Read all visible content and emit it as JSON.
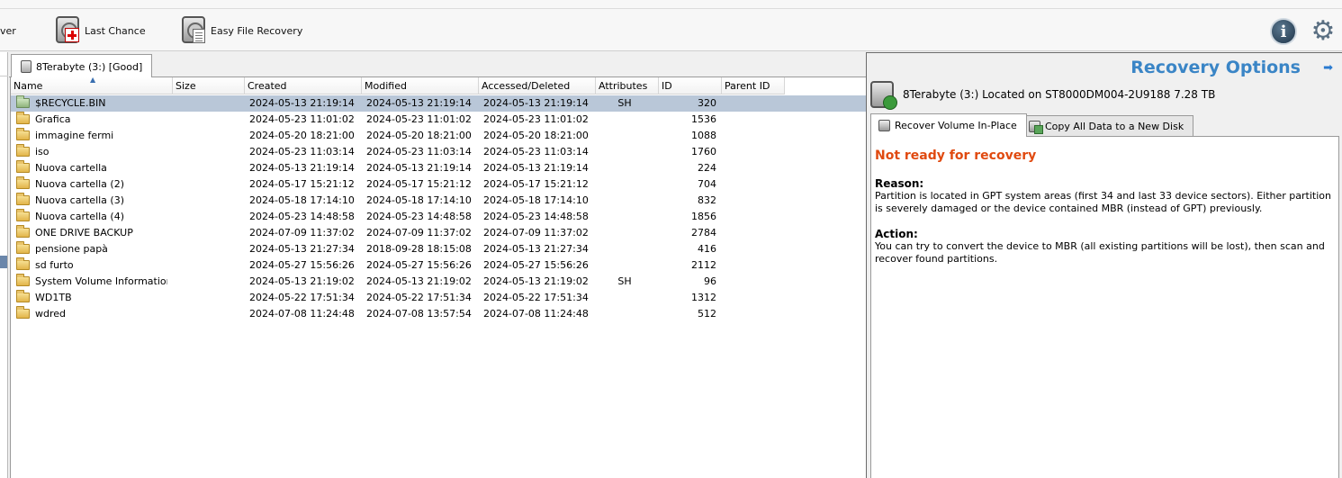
{
  "toolbar": {
    "partial_label": "ver",
    "last_chance_label": "Last Chance",
    "easy_file_recovery_label": "Easy File Recovery",
    "info_icon": "info-icon",
    "settings_icon": "gear-icon"
  },
  "drive_tab": {
    "label": "8Terabyte (3:) [Good]"
  },
  "file_list": {
    "columns": [
      "Name",
      "Size",
      "Created",
      "Modified",
      "Accessed/Deleted",
      "Attributes",
      "ID",
      "Parent ID"
    ],
    "sorted_column": "Name",
    "rows": [
      {
        "name": "$RECYCLE.BIN",
        "size": "",
        "created": "2024-05-13 21:19:14",
        "modified": "2024-05-13 21:19:14",
        "accessed": "2024-05-13 21:19:14",
        "attributes": "SH",
        "id": "320",
        "parent_id": "",
        "selected": true,
        "icon": "folder-system"
      },
      {
        "name": "Grafica",
        "size": "",
        "created": "2024-05-23 11:01:02",
        "modified": "2024-05-23 11:01:02",
        "accessed": "2024-05-23 11:01:02",
        "attributes": "",
        "id": "1536",
        "parent_id": "",
        "icon": "folder"
      },
      {
        "name": "immagine fermi",
        "size": "",
        "created": "2024-05-20 18:21:00",
        "modified": "2024-05-20 18:21:00",
        "accessed": "2024-05-20 18:21:00",
        "attributes": "",
        "id": "1088",
        "parent_id": "",
        "icon": "folder"
      },
      {
        "name": "iso",
        "size": "",
        "created": "2024-05-23 11:03:14",
        "modified": "2024-05-23 11:03:14",
        "accessed": "2024-05-23 11:03:14",
        "attributes": "",
        "id": "1760",
        "parent_id": "",
        "icon": "folder"
      },
      {
        "name": "Nuova cartella",
        "size": "",
        "created": "2024-05-13 21:19:14",
        "modified": "2024-05-13 21:19:14",
        "accessed": "2024-05-13 21:19:14",
        "attributes": "",
        "id": "224",
        "parent_id": "",
        "icon": "folder"
      },
      {
        "name": "Nuova cartella (2)",
        "size": "",
        "created": "2024-05-17 15:21:12",
        "modified": "2024-05-17 15:21:12",
        "accessed": "2024-05-17 15:21:12",
        "attributes": "",
        "id": "704",
        "parent_id": "",
        "icon": "folder"
      },
      {
        "name": "Nuova cartella (3)",
        "size": "",
        "created": "2024-05-18 17:14:10",
        "modified": "2024-05-18 17:14:10",
        "accessed": "2024-05-18 17:14:10",
        "attributes": "",
        "id": "832",
        "parent_id": "",
        "icon": "folder"
      },
      {
        "name": "Nuova cartella (4)",
        "size": "",
        "created": "2024-05-23 14:48:58",
        "modified": "2024-05-23 14:48:58",
        "accessed": "2024-05-23 14:48:58",
        "attributes": "",
        "id": "1856",
        "parent_id": "",
        "icon": "folder"
      },
      {
        "name": "ONE DRIVE BACKUP",
        "size": "",
        "created": "2024-07-09 11:37:02",
        "modified": "2024-07-09 11:37:02",
        "accessed": "2024-07-09 11:37:02",
        "attributes": "",
        "id": "2784",
        "parent_id": "",
        "icon": "folder"
      },
      {
        "name": "pensione papà",
        "size": "",
        "created": "2024-05-13 21:27:34",
        "modified": "2018-09-28 18:15:08",
        "accessed": "2024-05-13 21:27:34",
        "attributes": "",
        "id": "416",
        "parent_id": "",
        "icon": "folder"
      },
      {
        "name": "sd furto",
        "size": "",
        "created": "2024-05-27 15:56:26",
        "modified": "2024-05-27 15:56:26",
        "accessed": "2024-05-27 15:56:26",
        "attributes": "",
        "id": "2112",
        "parent_id": "",
        "icon": "folder"
      },
      {
        "name": "System Volume Information",
        "size": "",
        "created": "2024-05-13 21:19:02",
        "modified": "2024-05-13 21:19:02",
        "accessed": "2024-05-13 21:19:02",
        "attributes": "SH",
        "id": "96",
        "parent_id": "",
        "icon": "folder"
      },
      {
        "name": "WD1TB",
        "size": "",
        "created": "2024-05-22 17:51:34",
        "modified": "2024-05-22 17:51:34",
        "accessed": "2024-05-22 17:51:34",
        "attributes": "",
        "id": "1312",
        "parent_id": "",
        "icon": "folder"
      },
      {
        "name": "wdred",
        "size": "",
        "created": "2024-07-08 11:24:48",
        "modified": "2024-07-08 13:57:54",
        "accessed": "2024-07-08 11:24:48",
        "attributes": "",
        "id": "512",
        "parent_id": "",
        "icon": "folder"
      }
    ]
  },
  "recovery_panel": {
    "title": "Recovery Options",
    "drive_info": "8Terabyte (3:) Located on ST8000DM004-2U9188 7.28 TB",
    "tabs": [
      "Recover Volume In-Place",
      "Copy All Data to a New Disk"
    ],
    "status": "Not ready for recovery",
    "reason_heading": "Reason:",
    "reason_text": "Partition is located in GPT system areas (first 34 and last 33 device sectors). Either partition is severely damaged or the device contained MBR (instead of GPT) previously.",
    "action_heading": "Action:",
    "action_text": "You can try to convert the device to MBR (all existing partitions will be lost), then scan and recover found partitions.",
    "colors": {
      "title": "#3a85c6",
      "status": "#e04a10"
    }
  }
}
